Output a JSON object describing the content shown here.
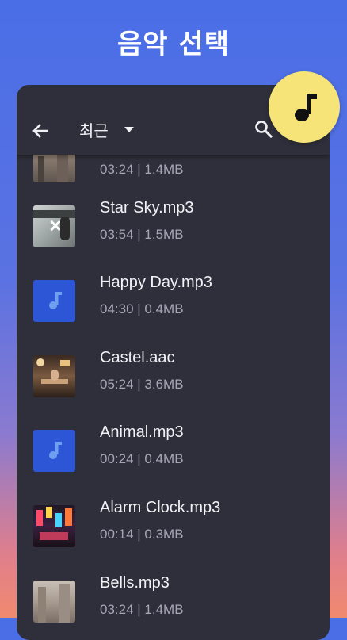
{
  "page": {
    "title": "음악 선택"
  },
  "toolbar": {
    "title": "최근"
  },
  "fab": {
    "icon": "music-note-icon",
    "color": "#f7e479"
  },
  "files": [
    {
      "name": "",
      "meta": "03:24 | 1.4MB",
      "thumb": "photo-street"
    },
    {
      "name": "Star Sky.mp3",
      "meta": "03:54 | 1.5MB",
      "thumb": "photo-board"
    },
    {
      "name": "Happy Day.mp3",
      "meta": "04:30 | 0.4MB",
      "thumb": "music-note"
    },
    {
      "name": "Castel.aac",
      "meta": "05:24 | 3.6MB",
      "thumb": "photo-cafe"
    },
    {
      "name": "Animal.mp3",
      "meta": "00:24 | 0.4MB",
      "thumb": "music-note"
    },
    {
      "name": "Alarm Clock.mp3",
      "meta": "00:14 | 0.3MB",
      "thumb": "photo-neon"
    },
    {
      "name": "Bells.mp3",
      "meta": "03:24 | 1.4MB",
      "thumb": "photo-street"
    }
  ]
}
